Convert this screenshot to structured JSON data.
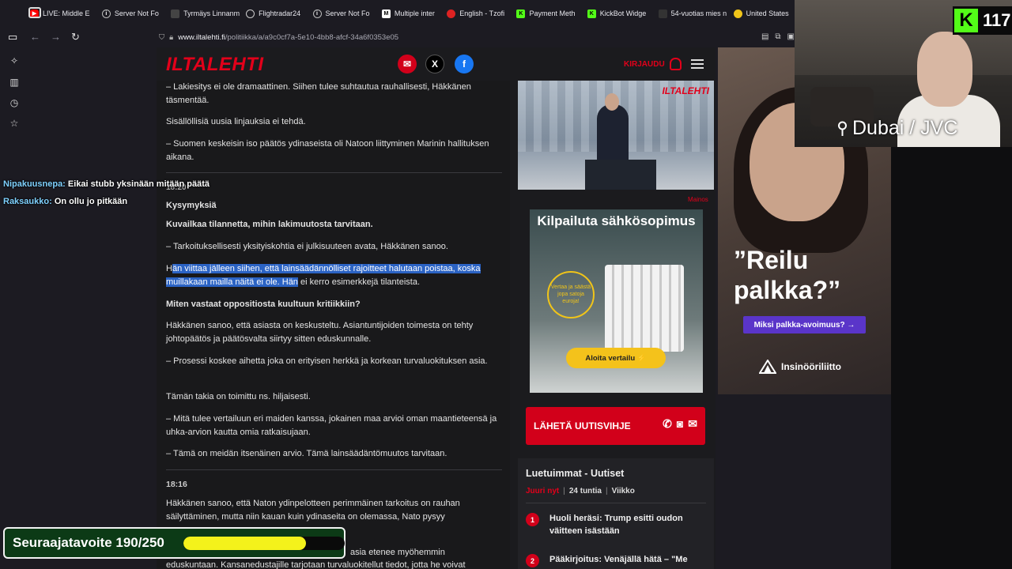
{
  "tabs": [
    {
      "label": "LIVE: Middle E",
      "icon": "youtube-icon",
      "color": "#ff0000"
    },
    {
      "label": "Server Not Fo",
      "icon": "info-icon",
      "color": "#bbbbbb"
    },
    {
      "label": "Tyrmäys Linnanmä",
      "icon": "page-icon",
      "color": "#777777"
    },
    {
      "label": "Flightradar24",
      "icon": "flightradar-icon",
      "color": "#cccccc"
    },
    {
      "label": "Server Not Fo",
      "icon": "info-icon",
      "color": "#bbbbbb"
    },
    {
      "label": "Multiple inter",
      "icon": "page-icon",
      "color": "#ffffff"
    },
    {
      "label": "English - Tzofi",
      "icon": "page-icon",
      "color": "#d22"
    },
    {
      "label": "Payment Meth",
      "icon": "kick-icon",
      "color": "#53fc18"
    },
    {
      "label": "KickBot Widge",
      "icon": "kickbot-icon",
      "color": "#53fc18"
    },
    {
      "label": "54-vuotias mies n",
      "icon": "page-icon",
      "color": "#444"
    },
    {
      "label": "United States",
      "icon": "maps-icon",
      "color": "#f0c419"
    }
  ],
  "url": {
    "host": "www.iltalehti.fi",
    "path": "/politiikka/a/a9c0cf7a-5e10-4bb8-afcf-34a6f0353e05"
  },
  "site": {
    "logo": "ILTALEHTI",
    "login": "KIRJAUDU",
    "brand_color": "#e2001a"
  },
  "article": {
    "p1": "–  Lakiesitys ei ole dramaattinen. Siihen tulee suhtautua rauhallisesti, Häkkänen täsmentää.",
    "p2": "Sisällöllisiä uusia linjauksia ei tehdä.",
    "p3": "–  Suomen keskeisin iso päätös ydinaseista oli Natoon liittyminen Marinin hallituksen aikana.",
    "time1": "18:20",
    "h1": "Kysymyksiä",
    "q1": "Kuvailkaa tilannetta, mihin lakimuutosta tarvitaan.",
    "p4": "–  Tarkoituksellisesti yksityiskohtia ei julkisuuteen avata, Häkkänen sanoo.",
    "p5_pre": "H",
    "p5_sel": "än viittaa jälleen siihen, että lainsäädännölliset rajoitteet halutaan poistaa, koska muillakaan mailla näitä ei ole. Hän",
    "p5_post": " ei kerro esimerkkejä tilanteista.",
    "q2": "Miten vastaat oppositiosta kuultuun kritiikkiin?",
    "p6": "Häkkänen sanoo, että asiasta on keskusteltu. Asiantuntijoiden toimesta on tehty johtopäätös ja päätösvalta siirtyy sitten eduskunnalle.",
    "p7": "–  Prosessi koskee aihetta joka on erityisen herkkä ja korkean turvaluokituksen asia.",
    "p8": "Tämän takia on toimittu ns. hiljaisesti.",
    "p9": "–  Mitä tulee vertailuun eri maiden kanssa, jokainen maa arvioi oman maantieteensä ja uhka-arvion kautta omia ratkaisujaan.",
    "p10": "–  Tämä on meidän itsenäinen arvio. Tämä lainsäädäntömuutos tarvitaan.",
    "time2": "18:16",
    "p11": "Häkkänen sanoo, että Naton ydinpelotteen perimmäinen tarkoitus on rauhan säilyttäminen, mutta niin kauan kuin ydinaseita on olemassa, Nato pysyy",
    "p12": "asia etenee myöhemmin",
    "p13": "eduskuntaan. Kansanedustajille tarjotaan turvaluokitellut tiedot, jotta he voivat"
  },
  "hero": {
    "tag": "ILTALEHTI"
  },
  "ad_label": "Mainos",
  "ad1": {
    "title": "Kilpailuta sähkösopimus",
    "badge": "Vertaa ja säästä jopa satoja euroja!",
    "button": "Aloita vertailu ⚡"
  },
  "tips": {
    "label": "LÄHETÄ UUTISVIHJE"
  },
  "popular": {
    "title": "Luetuimmat - Uutiset",
    "tabs": [
      "Juuri nyt",
      "24 tuntia",
      "Viikko"
    ],
    "items": [
      {
        "num": "1",
        "text": "Huoli heräsi: Trump esitti oudon väitteen isästään"
      },
      {
        "num": "2",
        "text": "Pääkirjoitus: Venäjällä hätä – \"Me"
      }
    ]
  },
  "ad2": {
    "quote": "”Reilu palkka?”",
    "button": "Miksi palkka-avoimuus? →",
    "brand": "Insinööriliitto"
  },
  "stream": {
    "location": "Dubai / JVC",
    "kick_count": "117",
    "kick_color": "#53fc18",
    "goal_text": "Seuraajatavoite 190/250",
    "goal_progress": 0.76,
    "chat": [
      {
        "user": "Nipakuusnepa:",
        "message": "Eikai stubb yksinään mitään päätä"
      },
      {
        "user": "Raksaukko:",
        "message": "On ollu jo pitkään"
      }
    ]
  }
}
